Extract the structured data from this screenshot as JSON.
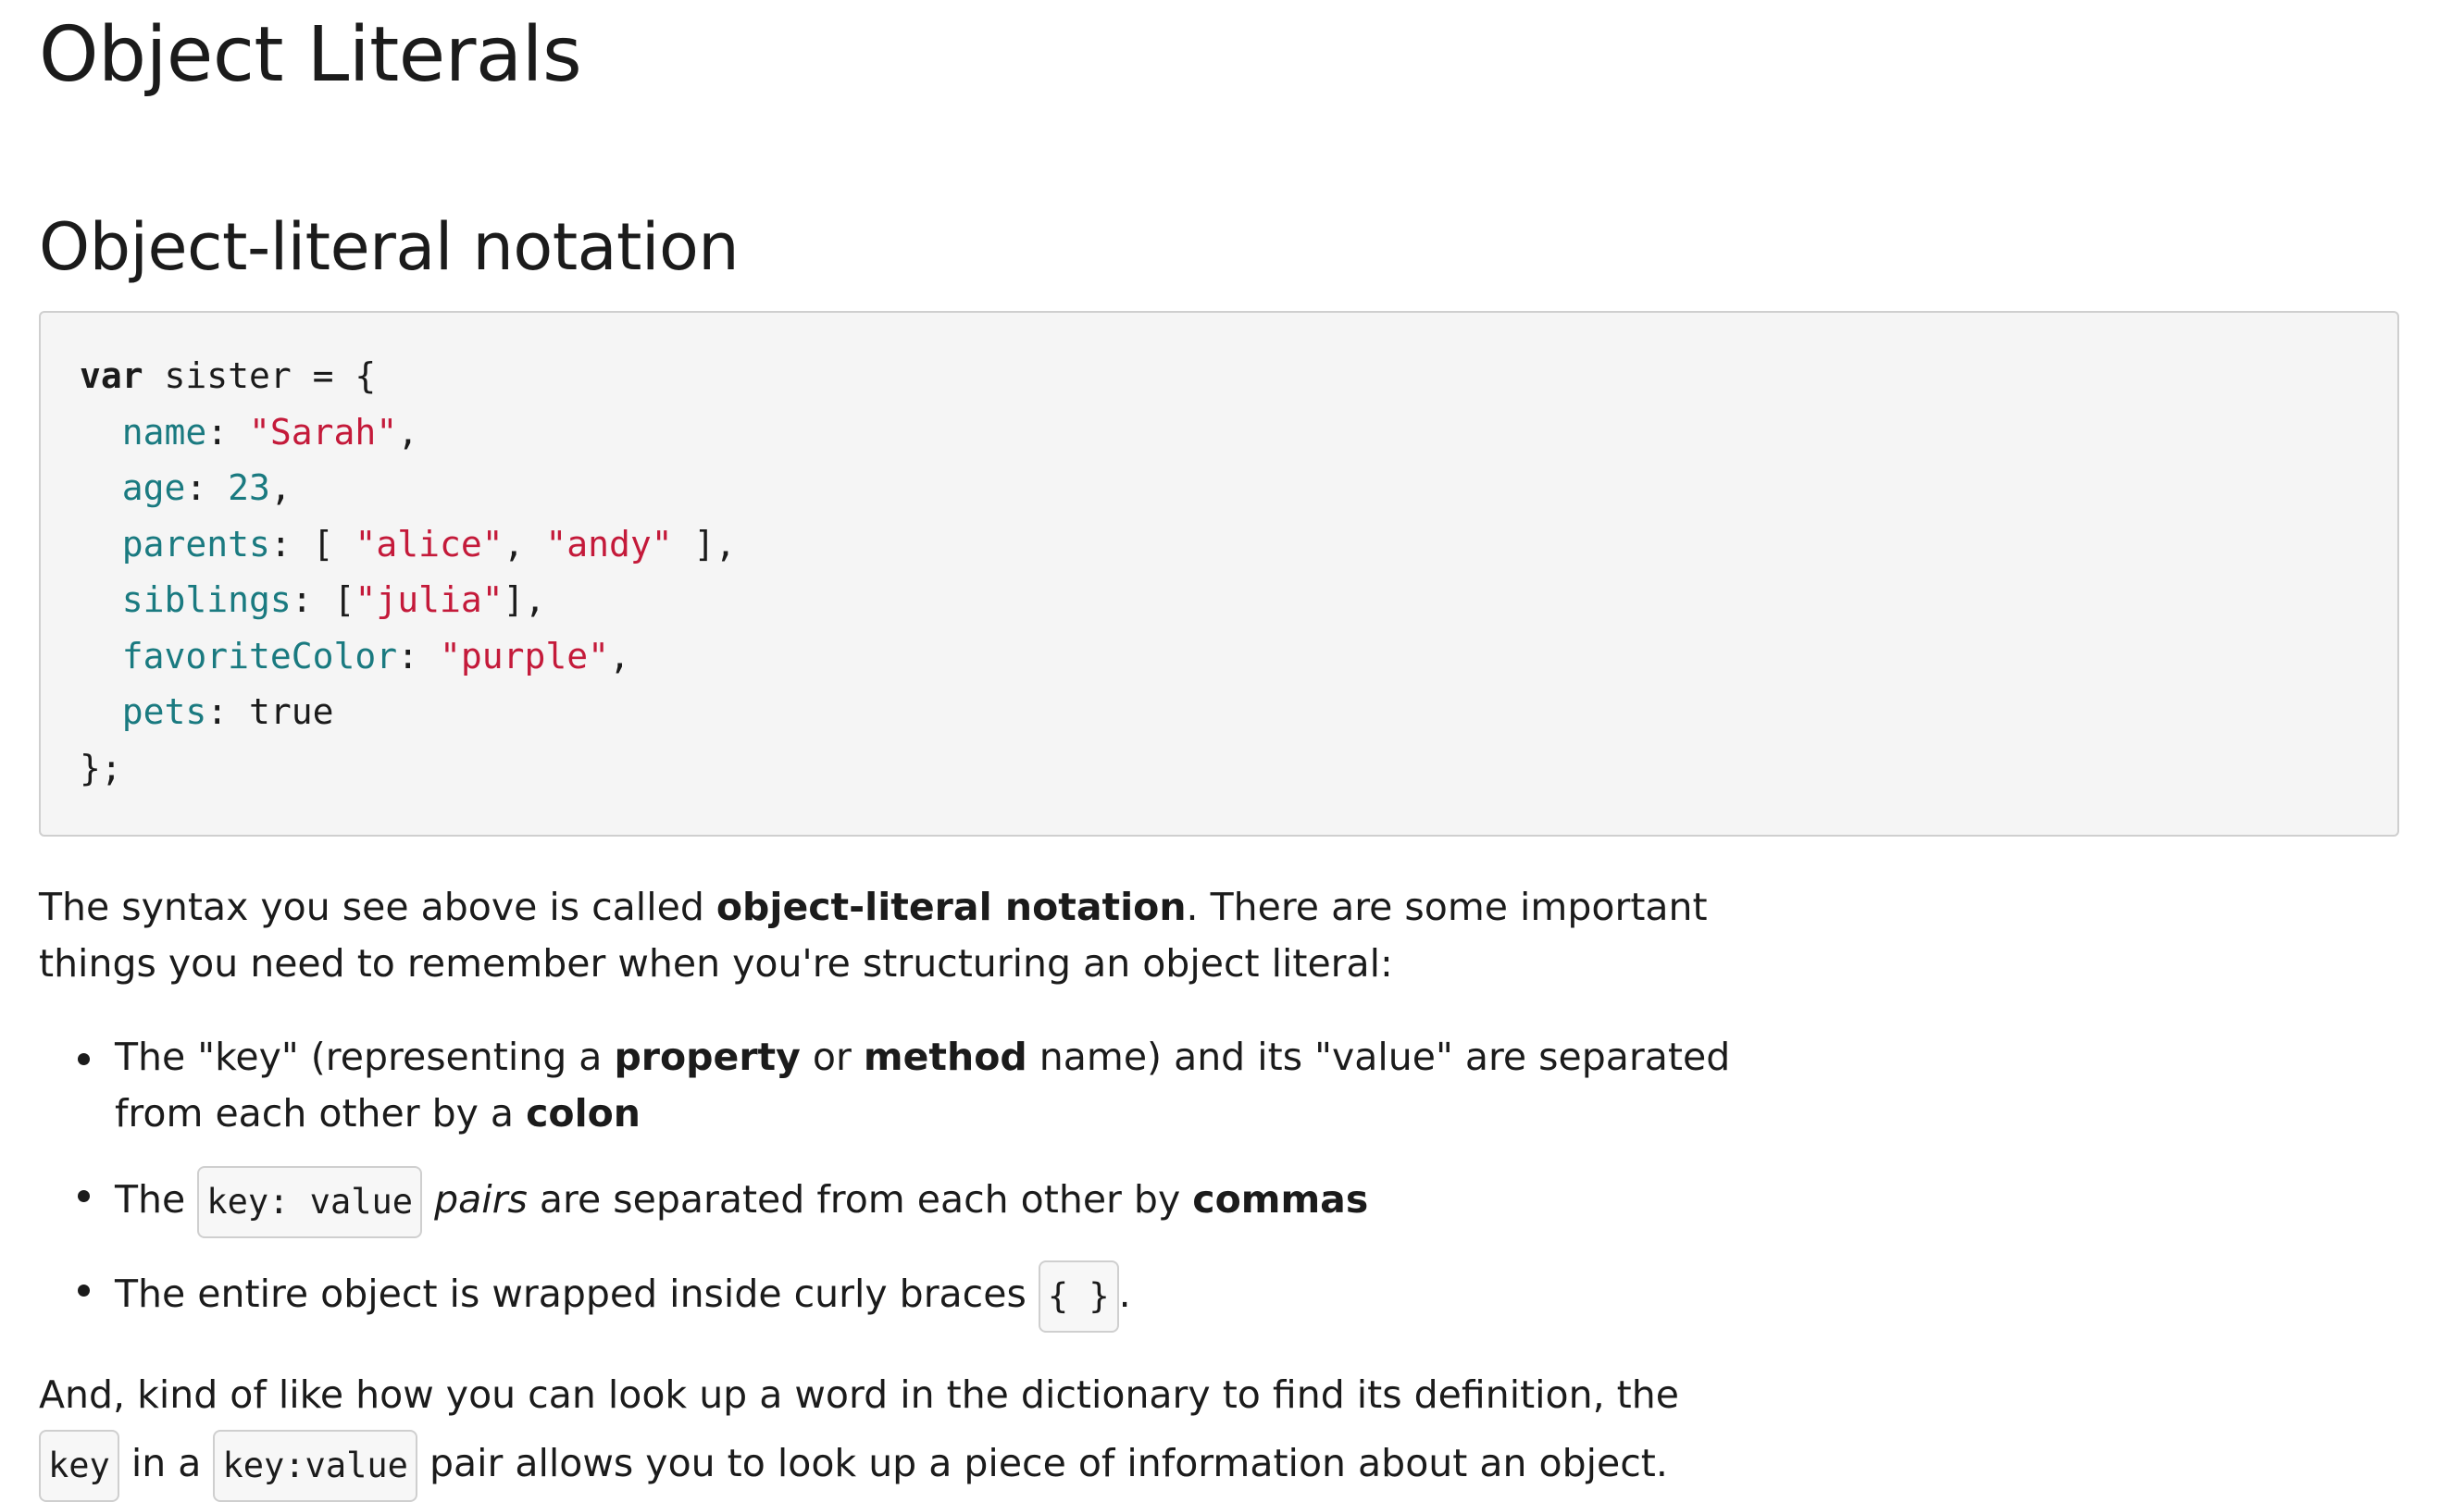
{
  "page": {
    "title": "Object Literals",
    "section_title": "Object-literal notation"
  },
  "code": {
    "line1": {
      "kw": "var",
      "rest": " sister = {"
    },
    "line2": {
      "indent": "  ",
      "prop": "name",
      "sep": ": ",
      "str": "\"Sarah\"",
      "end": ","
    },
    "line3": {
      "indent": "  ",
      "prop": "age",
      "sep": ": ",
      "num": "23",
      "end": ","
    },
    "line4": {
      "indent": "  ",
      "prop": "parents",
      "sep": ": [ ",
      "str1": "\"alice\"",
      "mid": ", ",
      "str2": "\"andy\"",
      "end": " ],"
    },
    "line5": {
      "indent": "  ",
      "prop": "siblings",
      "sep": ": [",
      "str": "\"julia\"",
      "end": "],"
    },
    "line6": {
      "indent": "  ",
      "prop": "favoriteColor",
      "sep": ": ",
      "str": "\"purple\"",
      "end": ","
    },
    "line7": {
      "indent": "  ",
      "prop": "pets",
      "sep": ": ",
      "val": "true"
    },
    "line8": {
      "text": "};"
    }
  },
  "intro": {
    "part1": "The syntax you see above is called ",
    "bold": "object-literal notation",
    "part2": ". There are some important",
    "line2": "things you need to remember when you're structuring an object literal:"
  },
  "bullets": {
    "b1": {
      "t1": "The \"key\" (representing a ",
      "bold1": "property",
      "t2": " or ",
      "bold2": "method",
      "t3": " name) and its \"value\" are separated",
      "line2": "from each other by a ",
      "bold3": "colon"
    },
    "b2": {
      "t1": "The ",
      "code": "key: value",
      "italic": "pairs",
      "t2": " are separated from each other by ",
      "bold": "commas"
    },
    "b3": {
      "t1": "The entire object is wrapped inside curly braces ",
      "code": "{ }",
      "t2": "."
    }
  },
  "outro": {
    "line1": "And, kind of like how you can look up a word in the dictionary to find its definition, the",
    "code1": "key",
    "t1": " in a ",
    "code2": "key:value",
    "t2": " pair allows you to look up a piece of information about an object."
  }
}
